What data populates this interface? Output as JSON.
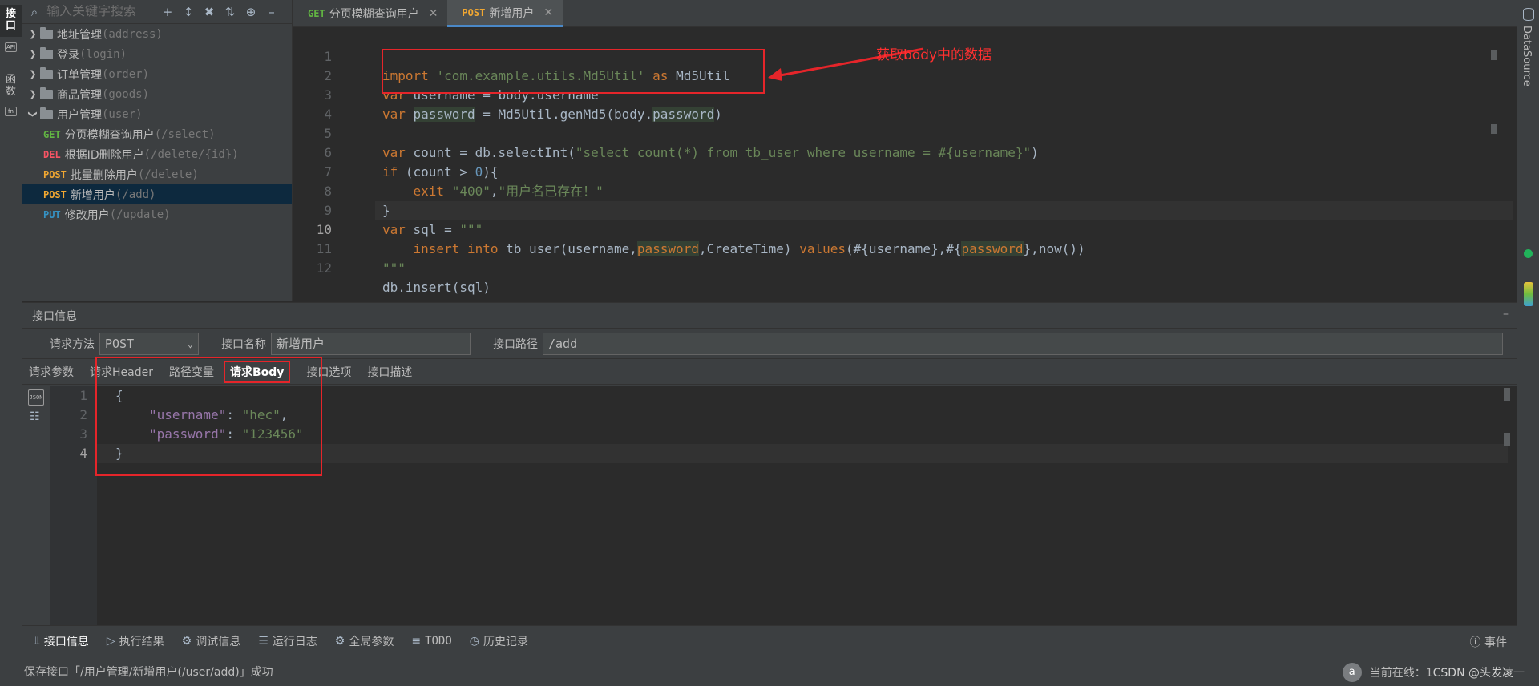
{
  "left_strip": {
    "tabs": [
      {
        "label": "接口",
        "active": true
      },
      {
        "label": "函数",
        "active": false
      }
    ],
    "icons": [
      "api-icon",
      "function-icon"
    ]
  },
  "right_strip": {
    "label": "DataSource"
  },
  "tree": {
    "search_placeholder": "输入关键字搜索",
    "toolbar_icons": [
      "add-icon",
      "expand-collapse-icon",
      "collapse-icon",
      "sort-icon",
      "locate-icon",
      "minimize-icon"
    ],
    "groups": [
      {
        "label": "地址管理",
        "path": "(address)",
        "expanded": false
      },
      {
        "label": "登录",
        "path": "(login)",
        "expanded": false
      },
      {
        "label": "订单管理",
        "path": "(order)",
        "expanded": false
      },
      {
        "label": "商品管理",
        "path": "(goods)",
        "expanded": false
      },
      {
        "label": "用户管理",
        "path": "(user)",
        "expanded": true
      }
    ],
    "items": [
      {
        "method": "GET",
        "label": "分页模糊查询用户",
        "path": "(/select)"
      },
      {
        "method": "DEL",
        "label": "根据ID删除用户",
        "path": "(/delete/{id})"
      },
      {
        "method": "POST",
        "label": "批量删除用户",
        "path": "(/delete)"
      },
      {
        "method": "POST",
        "label": "新增用户",
        "path": "(/add)",
        "selected": true
      },
      {
        "method": "PUT",
        "label": "修改用户",
        "path": "(/update)"
      }
    ]
  },
  "editor": {
    "tabs": [
      {
        "method": "GET",
        "label": "分页模糊查询用户",
        "active": false
      },
      {
        "method": "POST",
        "label": "新增用户",
        "active": true
      }
    ],
    "line_numbers": [
      "1",
      "2",
      "3",
      "4",
      "5",
      "6",
      "7",
      "8",
      "9",
      "10",
      "11",
      "12"
    ],
    "current_line": "10",
    "annotation": "获取body中的数据",
    "code": {
      "l1_kw": "import",
      "l1_str": "'com.example.utils.Md5Util'",
      "l1_as": "as",
      "l1_rest": "Md5Util",
      "l2_kw": "var",
      "l2_rest": "username = body.username",
      "l3_kw": "var",
      "l3_a": "password",
      "l3_b": " = Md5Util.genMd5(body.",
      "l3_c": "password",
      "l3_d": ")",
      "l5_kw": "var",
      "l5_a": " count = db.selectInt(",
      "l5_str": "\"select count(*) from tb_user where username = #{username}\"",
      "l5_b": ")",
      "l6_kw": "if",
      "l6_a": " (count > ",
      "l6_num": "0",
      "l6_b": "){",
      "l7_kw": "exit",
      "l7_s1": "\"400\"",
      "l7_c": ",",
      "l7_s2": "\"用户名已存在！\"",
      "l8": "}",
      "l9_kw": "var",
      "l9_a": " sql = ",
      "l9_str": "\"\"\"",
      "l10_k1": "insert into",
      "l10_a": " tb_user(username,",
      "l10_hl1": "password",
      "l10_b": ",CreateTime) ",
      "l10_k2": "values",
      "l10_c": "(#{username},#{",
      "l10_hl2": "password",
      "l10_d": "},now())",
      "l11": "\"\"\"",
      "l12": "db.insert(sql)"
    }
  },
  "panel": {
    "title": "接口信息",
    "method_label": "请求方法",
    "method_value": "POST",
    "name_label": "接口名称",
    "name_value": "新增用户",
    "path_label": "接口路径",
    "path_value": "/add",
    "tabs": [
      {
        "label": "请求参数",
        "active": false
      },
      {
        "label": "请求Header",
        "active": false
      },
      {
        "label": "路径变量",
        "active": false
      },
      {
        "label": "请求Body",
        "active": true
      },
      {
        "label": "接口选项",
        "active": false
      },
      {
        "label": "接口描述",
        "active": false
      }
    ],
    "json": {
      "line_numbers": [
        "1",
        "2",
        "3",
        "4"
      ],
      "open": "{",
      "k1": "\"username\"",
      "v1": "\"hec\"",
      "k2": "\"password\"",
      "v2": "\"123456\"",
      "close": "}"
    }
  },
  "bottom_bar": {
    "items": [
      {
        "label": "接口信息",
        "icon": "api-info-icon",
        "active": true
      },
      {
        "label": "执行结果",
        "icon": "run-icon",
        "active": false
      },
      {
        "label": "调试信息",
        "icon": "debug-icon",
        "active": false
      },
      {
        "label": "运行日志",
        "icon": "log-icon",
        "active": false
      },
      {
        "label": "全局参数",
        "icon": "gear-icon",
        "active": false
      },
      {
        "label": "TODO",
        "icon": "list-icon",
        "active": false
      },
      {
        "label": "历史记录",
        "icon": "history-icon",
        "active": false
      }
    ],
    "event_label": "事件"
  },
  "status": {
    "message": "保存接口「/用户管理/新增用户(/user/add)」成功",
    "avatar": "a",
    "online": "当前在线：1",
    "watermark": "CSDN @头发凌一"
  },
  "colors": {
    "background": "#2b2b2b",
    "panel": "#3c3f41",
    "keyword": "#cc7832",
    "string": "#6a8759",
    "annotation_red": "#e5252a",
    "get": "#62b543",
    "del": "#f75464",
    "post": "#f0a732",
    "put": "#3592c4"
  }
}
